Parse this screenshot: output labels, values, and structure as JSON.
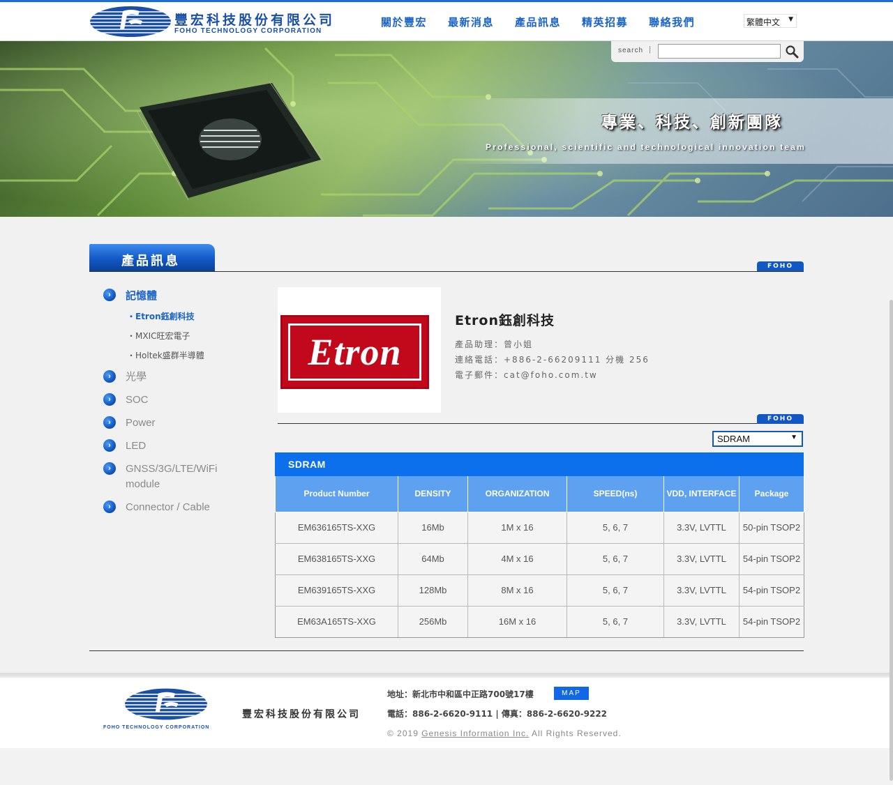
{
  "header": {
    "brand_zh": "豐宏科技股份有限公司",
    "brand_en": "FOHO TECHNOLOGY CORPORATION",
    "nav": [
      "關於豐宏",
      "最新消息",
      "產品訊息",
      "精英招募",
      "聯絡我們"
    ],
    "language": "繁體中文"
  },
  "banner": {
    "search_label": "search",
    "search_value": "",
    "slogan_zh": "專業、科技、創新團隊",
    "slogan_en": "Professional, scientific and technological innovation team"
  },
  "section": {
    "title": "產品訊息",
    "tag": "FOHO"
  },
  "sidebar": {
    "items": [
      {
        "label": "記憶體",
        "active": true
      },
      {
        "label": "光學",
        "active": false
      },
      {
        "label": "SOC",
        "active": false
      },
      {
        "label": "Power",
        "active": false
      },
      {
        "label": "LED",
        "active": false
      },
      {
        "label": "GNSS/3G/LTE/WiFi module",
        "active": false
      },
      {
        "label": "Connector / Cable",
        "active": false
      }
    ],
    "subitems": [
      {
        "label": "・Etron鈺創科技",
        "active": true
      },
      {
        "label": "・MXIC旺宏電子",
        "active": false
      },
      {
        "label": "・Holtek盛群半導體",
        "active": false
      }
    ]
  },
  "company": {
    "logo_text": "Etron",
    "name": "Etron鈺創科技",
    "assistant": "產品助理：曾小姐",
    "phone": "連絡電話：+886-2-66209111 分機 256",
    "email": "電子郵件：cat@foho.com.tw"
  },
  "filter": {
    "selected": "SDRAM"
  },
  "table": {
    "title": "SDRAM",
    "headers": [
      "Product Number",
      "DENSITY",
      "ORGANIZATION",
      "SPEED(ns)",
      "VDD, INTERFACE",
      "Package"
    ],
    "rows": [
      [
        "EM636165TS-XXG",
        "16Mb",
        "1M x 16",
        "5, 6, 7",
        "3.3V, LVTTL",
        "50-pin TSOP2"
      ],
      [
        "EM638165TS-XXG",
        "64Mb",
        "4M x 16",
        "5, 6, 7",
        "3.3V, LVTTL",
        "54-pin TSOP2"
      ],
      [
        "EM639165TS-XXG",
        "128Mb",
        "8M x 16",
        "5, 6, 7",
        "3.3V, LVTTL",
        "54-pin TSOP2"
      ],
      [
        "EM63A165TS-XXG",
        "256Mb",
        "16M x 16",
        "5, 6, 7",
        "3.3V, LVTTL",
        "54-pin TSOP2"
      ]
    ]
  },
  "footer": {
    "logo_en": "FOHO TECHNOLOGY CORPORATION",
    "brand": "豐宏科技股份有限公司",
    "address": "地址：新北市中和區中正路700號17樓",
    "map_label": "MAP",
    "contact": "電話：886-2-6620-9111 | 傳真：886-2-6620-9222",
    "copyright_prefix": "© 2019",
    "copyright_link": "Genesis Information Inc.",
    "copyright_suffix": "All Rights Reserved."
  },
  "colors": {
    "brand_blue": "#1158c4",
    "nav_blue": "#1a63c8",
    "table_header": "#5da1f0",
    "table_title": "#0c6fec",
    "etron_red": "#c2091b"
  }
}
